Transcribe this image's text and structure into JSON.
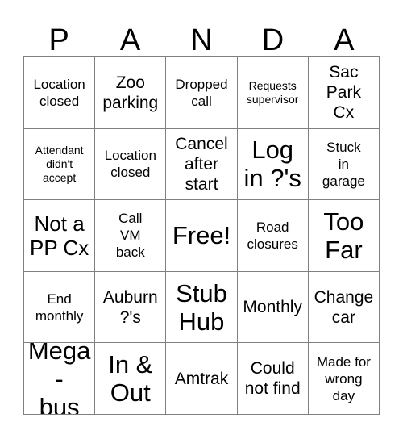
{
  "card": {
    "title_letters": [
      "P",
      "A",
      "N",
      "D",
      "A"
    ],
    "columns": 5,
    "rows": 5,
    "free_space_label": "Free!",
    "border_color": "#808080",
    "text_color": "#000000",
    "background_color": "#ffffff",
    "cells": [
      {
        "text": "Location\nclosed",
        "size": "s"
      },
      {
        "text": "Zoo\nparking",
        "size": "m"
      },
      {
        "text": "Dropped\ncall",
        "size": "s"
      },
      {
        "text": "Requests\nsupervisor",
        "size": "xs"
      },
      {
        "text": "Sac\nPark\nCx",
        "size": "m"
      },
      {
        "text": "Attendant\ndidn't\naccept",
        "size": "xs"
      },
      {
        "text": "Location\nclosed",
        "size": "s"
      },
      {
        "text": "Cancel\nafter\nstart",
        "size": "m"
      },
      {
        "text": "Log\nin ?'s",
        "size": "xl"
      },
      {
        "text": "Stuck\nin\ngarage",
        "size": "s"
      },
      {
        "text": "Not a\nPP Cx",
        "size": "l"
      },
      {
        "text": "Call\nVM\nback",
        "size": "s"
      },
      {
        "text": "Free!",
        "size": "xl"
      },
      {
        "text": "Road\nclosures",
        "size": "s"
      },
      {
        "text": "Too\nFar",
        "size": "xl"
      },
      {
        "text": "End\nmonthly",
        "size": "s"
      },
      {
        "text": "Auburn\n?'s",
        "size": "m"
      },
      {
        "text": "Stub\nHub",
        "size": "xl"
      },
      {
        "text": "Monthly",
        "size": "m"
      },
      {
        "text": "Change\ncar",
        "size": "m"
      },
      {
        "text": "Mega-\nbus",
        "size": "xl"
      },
      {
        "text": "In &\nOut",
        "size": "xl"
      },
      {
        "text": "Amtrak",
        "size": "m"
      },
      {
        "text": "Could\nnot find",
        "size": "m"
      },
      {
        "text": "Made for\nwrong\nday",
        "size": "s"
      }
    ]
  }
}
